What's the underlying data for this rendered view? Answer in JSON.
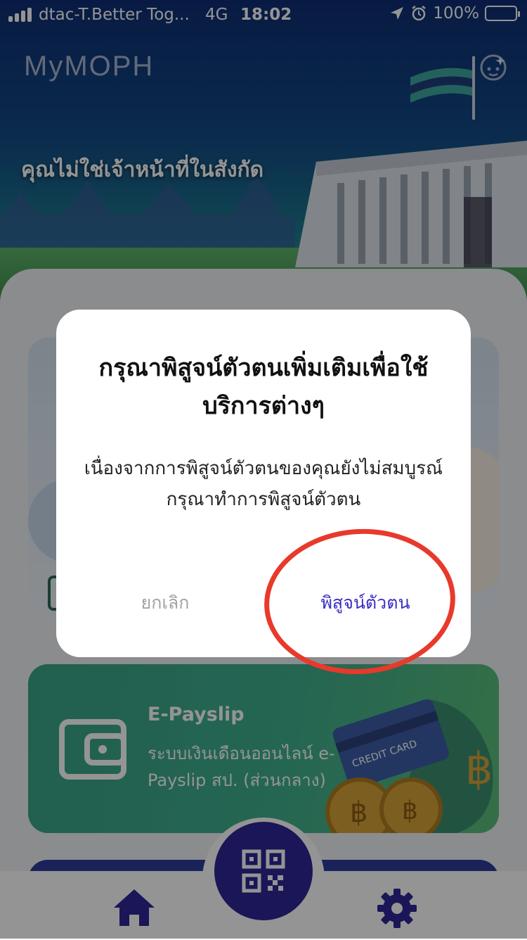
{
  "status_bar": {
    "carrier": "dtac-T.Better Tog...",
    "network": "4G",
    "time": "18:02",
    "battery": "100%"
  },
  "header": {
    "logo": "MyMOPH",
    "headline": "คุณไม่ใช่เจ้าหน้าที่ในสังกัด"
  },
  "cards": {
    "payslip": {
      "title": "E-Payslip",
      "description": "ระบบเงินเดือนออนไลน์ e-Payslip สป. (ส่วนกลาง)",
      "money_text": "CREDIT CARD",
      "coin_symbol": "฿"
    }
  },
  "dialog": {
    "title": "กรุณาพิสูจน์ตัวตนเพิ่มเติมเพื่อใช้บริการต่างๆ",
    "body": "เนื่องจากการพิสูจน์ตัวตนของคุณยังไม่สมบูรณ์ กรุณาทำการพิสูจน์ตัวตน",
    "cancel_label": "ยกเลิก",
    "confirm_label": "พิสูจน์ตัวตน"
  },
  "icons": {
    "home": "home-icon",
    "qr": "qr-code-icon",
    "settings": "gear-icon",
    "wallet": "wallet-icon",
    "face": "face-icon"
  },
  "colors": {
    "accent": "#2e2796",
    "confirm": "#3a2fc4",
    "highlight": "#e8392b",
    "payslip_card": "#40b08f"
  }
}
